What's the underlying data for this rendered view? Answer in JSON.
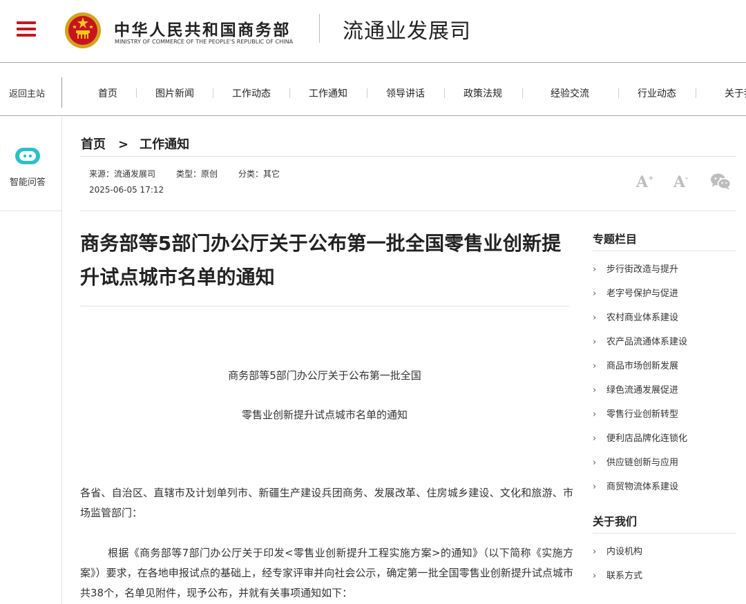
{
  "header": {
    "ministry_cn": "中华人民共和国商务部",
    "ministry_en": "MINISTRY OF COMMERCE OF THE PEOPLE'S REPUBLIC OF CHINA",
    "department": "流通业发展司",
    "brand_color": "#c8141e"
  },
  "nav": {
    "back_home": "返回主站",
    "items": [
      "首页",
      "图片新闻",
      "工作动态",
      "工作通知",
      "领导讲话",
      "政策法规",
      "经验交流",
      "行业动态",
      "关于我"
    ]
  },
  "left_sidebar": {
    "ai_label": "智能问答",
    "ai_icon_color": "#2bc0c8"
  },
  "breadcrumb": {
    "home": "首页",
    "separator": ">",
    "current": "工作通知"
  },
  "meta": {
    "source": "来源：流通发展司",
    "type": "类型：原创",
    "category": "分类：其它",
    "date": "2025-06-05 17:12"
  },
  "tools": {
    "font_large": "A",
    "font_small": "A"
  },
  "article": {
    "title": "商务部等5部门办公厅关于公布第一批全国零售业创新提升试点城市名单的通知",
    "subtitle_line1": "商务部等5部门办公厅关于公布第一批全国",
    "subtitle_line2": "零售业创新提升试点城市名单的通知",
    "salutation": "各省、自治区、直辖市及计划单列市、新疆生产建设兵团商务、发展改革、住房城乡建设、文化和旅游、市场监管部门：",
    "body_p1": "根据《商务部等7部门办公厅关于印发<零售业创新提升工程实施方案>的通知》（以下简称《实施方案》）要求，在各地申报试点的基础上，经专家评审并向社会公示，确定第一批全国零售业创新提升试点城市共38个，名单见附件，现予公布，并就有关事项通知如下："
  },
  "right_sidebar": {
    "topics_heading": "专题栏目",
    "topics": [
      "步行街改造与提升",
      "老字号保护与促进",
      "农村商业体系建设",
      "农产品流通体系建设",
      "商品市场创新发展",
      "绿色流通发展促进",
      "零售行业创新转型",
      "便利店品牌化连锁化",
      "供应链创新与应用",
      "商贸物流体系建设"
    ],
    "about_heading": "关于我们",
    "about": [
      "内设机构",
      "联系方式"
    ]
  }
}
